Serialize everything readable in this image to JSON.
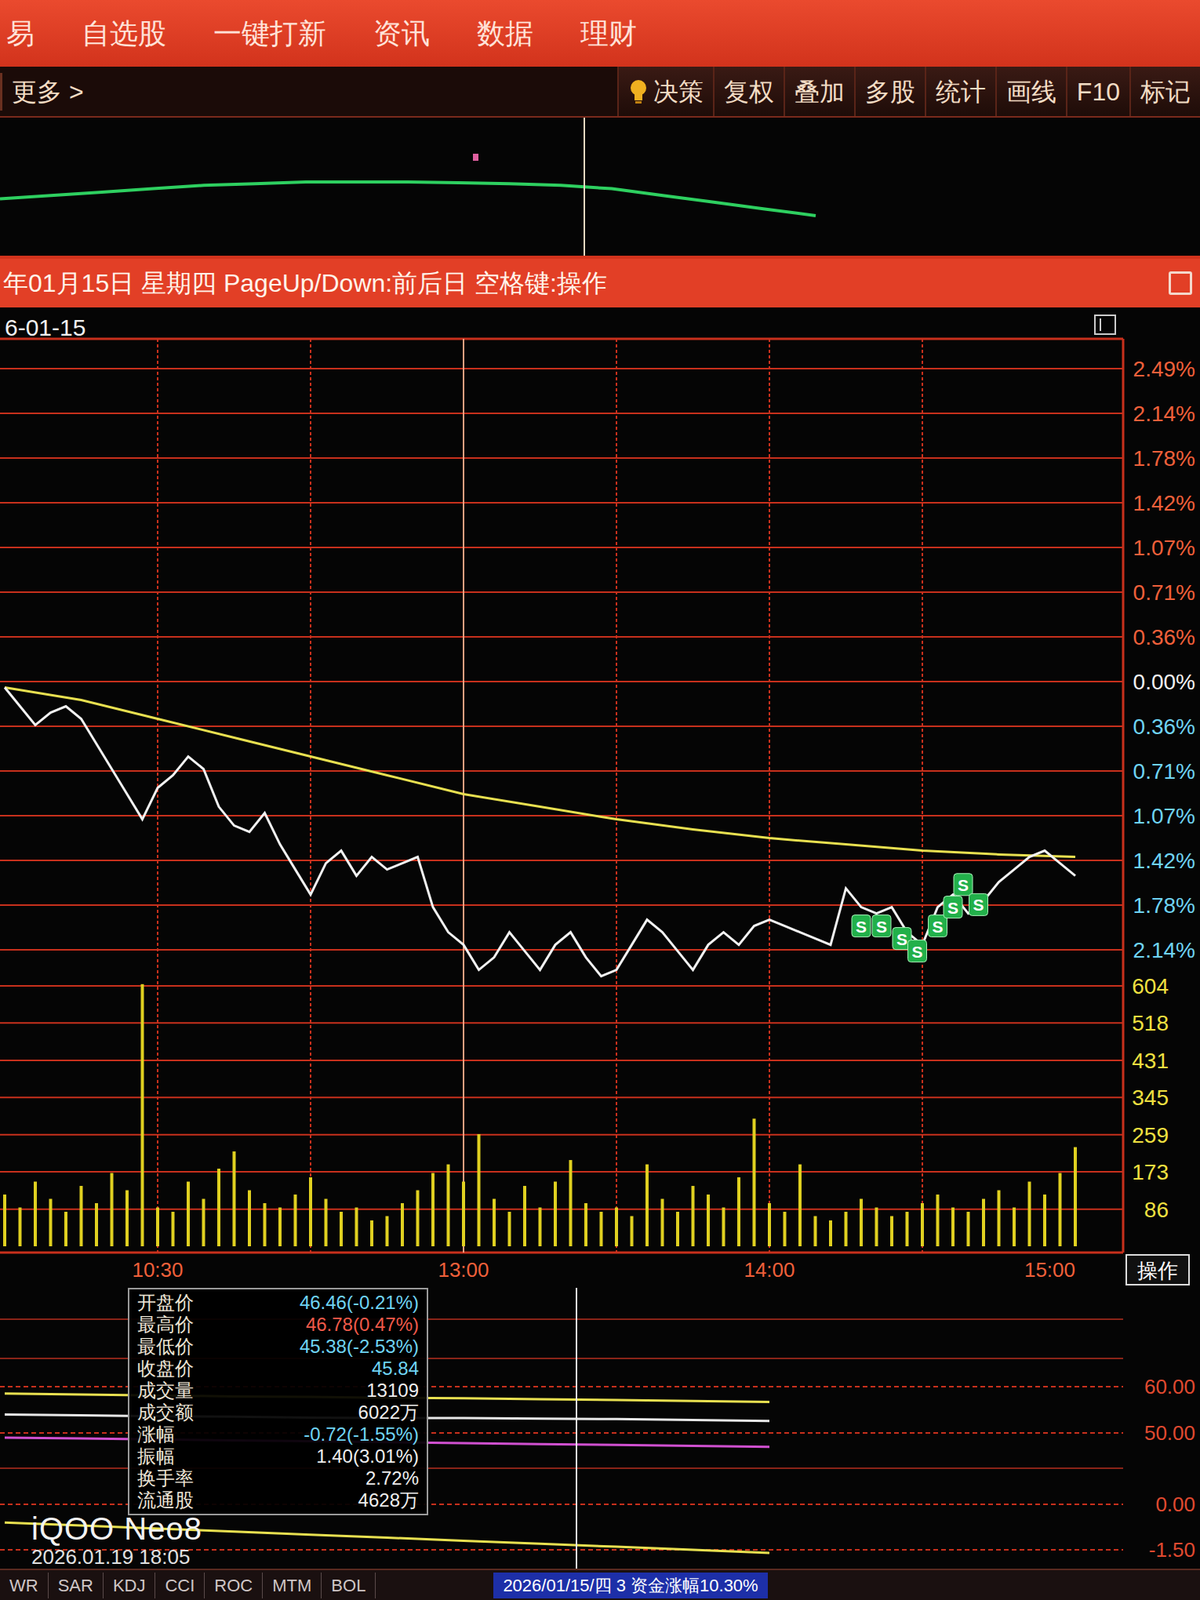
{
  "menu": [
    "易",
    "自选股",
    "一键打新",
    "资讯",
    "数据",
    "理财"
  ],
  "toolbar": {
    "more": "更多 >",
    "buttons": [
      {
        "label": "决策",
        "kind": "bulb"
      },
      {
        "label": "复权",
        "kind": "plain"
      },
      {
        "label": "叠加",
        "kind": "plain"
      },
      {
        "label": "多股",
        "kind": "plain"
      },
      {
        "label": "统计",
        "kind": "plain"
      },
      {
        "label": "画线",
        "kind": "plain"
      },
      {
        "label": "F10",
        "kind": "plain"
      },
      {
        "label": "标记",
        "kind": "plain"
      }
    ]
  },
  "index_strip": {
    "values": [
      10,
      11,
      12,
      13,
      14,
      14.5,
      15,
      15,
      15,
      14.8,
      14.5,
      14,
      13,
      11,
      9,
      7,
      5
    ]
  },
  "title_bar": {
    "text": "年01月15日 星期四 PageUp/Down:前后日 空格键:操作"
  },
  "chart": {
    "date": "6-01-15",
    "price_ticks": [
      {
        "label": "2.49%",
        "value": 2.49,
        "color": "#f0603a"
      },
      {
        "label": "2.14%",
        "value": 2.14,
        "color": "#f0603a"
      },
      {
        "label": "1.78%",
        "value": 1.78,
        "color": "#f0603a"
      },
      {
        "label": "1.42%",
        "value": 1.42,
        "color": "#f0603a"
      },
      {
        "label": "1.07%",
        "value": 1.07,
        "color": "#f0603a"
      },
      {
        "label": "0.71%",
        "value": 0.71,
        "color": "#f0603a"
      },
      {
        "label": "0.36%",
        "value": 0.36,
        "color": "#f0603a"
      },
      {
        "label": "0.00%",
        "value": 0,
        "color": "#f2f2f2"
      },
      {
        "label": "0.36%",
        "value": -0.36,
        "color": "#6fd4f4"
      },
      {
        "label": "0.71%",
        "value": -0.71,
        "color": "#6fd4f4"
      },
      {
        "label": "1.07%",
        "value": -1.07,
        "color": "#6fd4f4"
      },
      {
        "label": "1.42%",
        "value": -1.42,
        "color": "#6fd4f4"
      },
      {
        "label": "1.78%",
        "value": -1.78,
        "color": "#6fd4f4"
      },
      {
        "label": "2.14%",
        "value": -2.14,
        "color": "#6fd4f4"
      }
    ],
    "volume_ticks": [
      {
        "label": "604",
        "value": 604
      },
      {
        "label": "518",
        "value": 518
      },
      {
        "label": "431",
        "value": 431
      },
      {
        "label": "345",
        "value": 345
      },
      {
        "label": "259",
        "value": 259
      },
      {
        "label": "173",
        "value": 173
      },
      {
        "label": "86",
        "value": 86
      }
    ],
    "time_ticks": [
      {
        "label": "10:30",
        "minute": 30
      },
      {
        "label": "13:00",
        "minute": 90
      },
      {
        "label": "14:00",
        "minute": 150
      },
      {
        "label": "15:00",
        "minute": 210
      }
    ],
    "action_label": "操作",
    "price_series": {
      "step": 3,
      "values": [
        -0.05,
        -0.2,
        -0.35,
        -0.25,
        -0.2,
        -0.3,
        -0.5,
        -0.7,
        -0.9,
        -1.1,
        -0.85,
        -0.75,
        -0.6,
        -0.7,
        -1.0,
        -1.15,
        -1.2,
        -1.05,
        -1.3,
        -1.5,
        -1.7,
        -1.45,
        -1.35,
        -1.55,
        -1.4,
        -1.5,
        -1.45,
        -1.4,
        -1.8,
        -2.0,
        -2.1,
        -2.3,
        -2.2,
        -2.0,
        -2.15,
        -2.3,
        -2.1,
        -2.0,
        -2.2,
        -2.35,
        -2.3,
        -2.1,
        -1.9,
        -2.0,
        -2.15,
        -2.3,
        -2.1,
        -2.0,
        -2.1,
        -1.95,
        -1.9,
        -1.95,
        -2.0,
        -2.05,
        -2.1,
        -1.65,
        -1.8,
        -1.85,
        -1.8,
        -2.0,
        -2.1,
        -1.8,
        -1.7,
        -1.85,
        -1.75,
        -1.6,
        -1.5,
        -1.4,
        -1.35,
        -1.45,
        -1.55
      ]
    },
    "avg_series": {
      "step": 15,
      "values": [
        -0.05,
        -0.15,
        -0.3,
        -0.45,
        -0.6,
        -0.75,
        -0.9,
        -1.0,
        -1.1,
        -1.18,
        -1.25,
        -1.3,
        -1.35,
        -1.38,
        -1.4
      ]
    },
    "volume_series": {
      "step": 3,
      "values": [
        120,
        90,
        150,
        110,
        80,
        140,
        100,
        170,
        130,
        608,
        90,
        80,
        150,
        110,
        180,
        220,
        130,
        100,
        90,
        120,
        160,
        110,
        80,
        90,
        60,
        70,
        100,
        130,
        170,
        190,
        150,
        260,
        110,
        80,
        140,
        90,
        150,
        200,
        100,
        80,
        90,
        70,
        190,
        110,
        80,
        140,
        120,
        90,
        160,
        296,
        100,
        80,
        190,
        70,
        60,
        80,
        110,
        90,
        70,
        80,
        100,
        120,
        90,
        80,
        110,
        130,
        90,
        150,
        120,
        170,
        230
      ]
    },
    "marks": [
      {
        "label": "S",
        "minute": 168,
        "value": -1.95
      },
      {
        "label": "S",
        "minute": 172,
        "value": -1.95
      },
      {
        "label": "S",
        "minute": 176,
        "value": -2.05
      },
      {
        "label": "S",
        "minute": 179,
        "value": -2.15
      },
      {
        "label": "S",
        "minute": 183,
        "value": -1.95
      },
      {
        "label": "S",
        "minute": 186,
        "value": -1.8
      },
      {
        "label": "S",
        "minute": 188,
        "value": -1.62
      },
      {
        "label": "S",
        "minute": 191,
        "value": -1.78
      }
    ]
  },
  "info_panel": [
    {
      "label": "开盘价",
      "value": "46.46(-0.21%)",
      "color": "#6fd4f4"
    },
    {
      "label": "最高价",
      "value": "46.78(0.47%)",
      "color": "#f05a4a"
    },
    {
      "label": "最低价",
      "value": "45.38(-2.53%)",
      "color": "#6fd4f4"
    },
    {
      "label": "收盘价",
      "value": "45.84",
      "color": "#6fd4f4"
    },
    {
      "label": "成交量",
      "value": "13109",
      "color": "#eeeeee"
    },
    {
      "label": "成交额",
      "value": "6022万",
      "color": "#eeeeee"
    },
    {
      "label": "涨幅",
      "value": "-0.72(-1.55%)",
      "color": "#6fd4f4"
    },
    {
      "label": "振幅",
      "value": "1.40(3.01%)",
      "color": "#eeeeee"
    },
    {
      "label": "换手率",
      "value": "2.72%",
      "color": "#eeeeee"
    },
    {
      "label": "流通股",
      "value": "4628万",
      "color": "#eeeeee"
    }
  ],
  "indicator": {
    "panels": [
      {
        "ticks": [
          {
            "label": "60.00",
            "value": 60
          },
          {
            "label": "50.00",
            "value": 50
          }
        ],
        "series": [
          {
            "color": "#e8e050",
            "step": 15,
            "values": [
              58.5,
              58.3,
              58.1,
              57.9,
              57.8,
              57.6,
              57.5,
              57.3,
              57.1,
              56.9,
              56.7
            ]
          },
          {
            "color": "#e8e8e8",
            "step": 15,
            "values": [
              54,
              53.8,
              53.6,
              53.5,
              53.3,
              53.2,
              53.2,
              53.1,
              53,
              52.8,
              52.6
            ]
          },
          {
            "color": "#d050d0",
            "step": 15,
            "values": [
              49,
              48.8,
              48.6,
              48.4,
              48.2,
              48,
              47.8,
              47.6,
              47.4,
              47.2,
              47
            ]
          }
        ]
      },
      {
        "ticks": [
          {
            "label": "0.00",
            "value": 0
          },
          {
            "label": "-1.50",
            "value": -1.5
          }
        ],
        "series": [
          {
            "color": "#e8e050",
            "step": 15,
            "values": [
              -0.6,
              -0.7,
              -0.8,
              -0.9,
              -1.0,
              -1.1,
              -1.2,
              -1.3,
              -1.4,
              -1.5,
              -1.6
            ]
          }
        ]
      }
    ]
  },
  "indicator_tabs": [
    "WR",
    "SAR",
    "KDJ",
    "CCI",
    "ROC",
    "MTM",
    "BOL"
  ],
  "status_text": "2026/01/15/四 3 资金涨幅10.30%",
  "watermark": {
    "brand": "iQOO Neo8",
    "time": "2026.01.19 18:05"
  }
}
